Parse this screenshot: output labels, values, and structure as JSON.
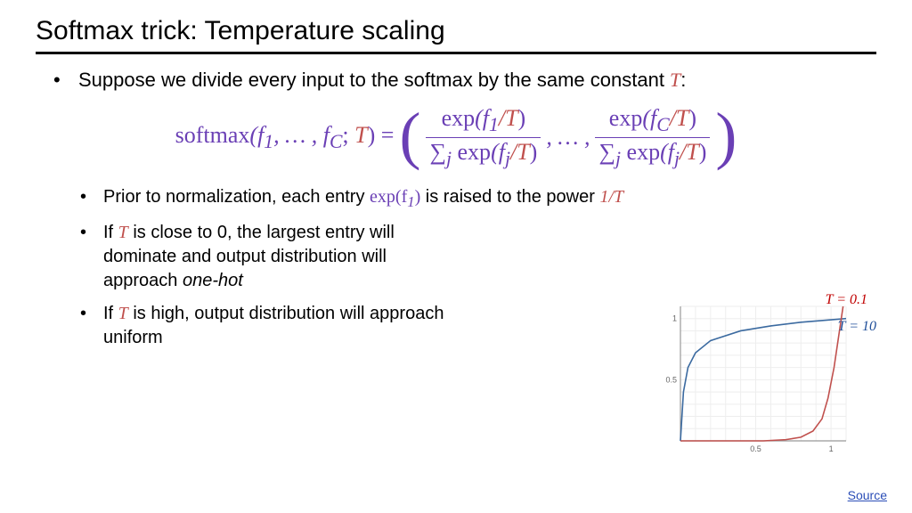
{
  "title": "Softmax trick: Temperature scaling",
  "bullet1_pre": "Suppose we divide every input to the softmax by the same constant ",
  "bullet1_T": "T",
  "bullet1_post": ":",
  "formula": {
    "softmax": "softmax",
    "args_pre": "(f",
    "args_sub1": "1",
    "args_mid": ", … , f",
    "args_subC": "C",
    "args_semi": "; ",
    "T": "T",
    "args_close": ") = ",
    "exp": "exp",
    "f1": "(f",
    "sub1": "1",
    "slashT": "/T",
    "close": ")",
    "sum": "∑",
    "sumj": "j",
    "fj_open": "(f",
    "fj_sub": "j",
    "dots": ", … ,",
    "fC_open": "(f",
    "fC_sub": "C"
  },
  "sub1_a": "Prior to normalization, each entry ",
  "sub1_exp": "exp(f",
  "sub1_sub": "1",
  "sub1_close": ")",
  "sub1_b": " is raised to the power ",
  "sub1_pow": "1/T",
  "sub2_a": "If ",
  "sub2_T": "T",
  "sub2_b": " is close to 0, the largest entry will dominate and output distribution will approach ",
  "sub2_c": "one-hot",
  "sub3_a": "If ",
  "sub3_T": "T",
  "sub3_b": " is high, output distribution will approach uniform",
  "chart_label_red": "T = 0.1",
  "chart_label_blue": "T = 10",
  "source": "Source",
  "chart_data": {
    "type": "line",
    "xlim": [
      0,
      1.1
    ],
    "ylim": [
      0,
      1.1
    ],
    "xlabel": "",
    "ylabel": "",
    "xticks": [
      0.5,
      1
    ],
    "yticks": [
      0.5,
      1
    ],
    "series": [
      {
        "name": "T = 10",
        "color": "#3b6aa0",
        "x": [
          0.0,
          0.02,
          0.05,
          0.1,
          0.2,
          0.4,
          0.6,
          0.8,
          1.0,
          1.1
        ],
        "y": [
          0.0,
          0.4,
          0.6,
          0.72,
          0.82,
          0.9,
          0.94,
          0.97,
          0.99,
          1.0
        ]
      },
      {
        "name": "T = 0.1",
        "color": "#c0504d",
        "x": [
          0.0,
          0.55,
          0.7,
          0.8,
          0.88,
          0.94,
          0.98,
          1.02,
          1.05,
          1.08
        ],
        "y": [
          0.0,
          0.0,
          0.01,
          0.03,
          0.08,
          0.18,
          0.35,
          0.6,
          0.85,
          1.1
        ]
      }
    ]
  }
}
